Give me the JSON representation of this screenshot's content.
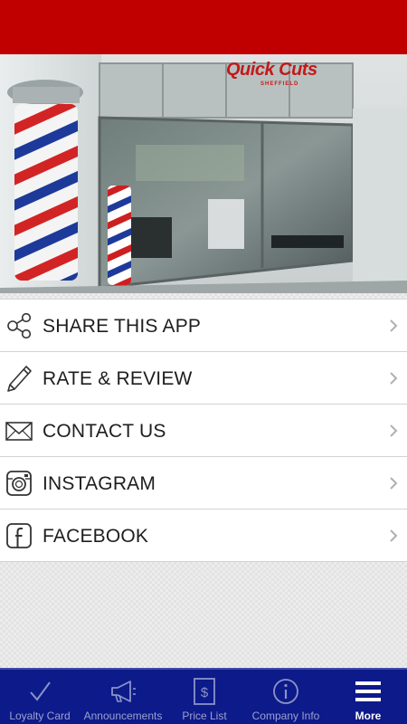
{
  "colors": {
    "header": "#c00000",
    "tab_bar": "#0d1a8a",
    "tab_label": "#9aa1cf",
    "tab_label_active": "#ffffff"
  },
  "hero": {
    "shop_sign": "Quick Cuts",
    "shop_sign_sub": "SHEFFIELD"
  },
  "menu": {
    "items": [
      {
        "label": "SHARE THIS APP",
        "icon": "share-icon"
      },
      {
        "label": "RATE & REVIEW",
        "icon": "pencil-icon"
      },
      {
        "label": "CONTACT US",
        "icon": "envelope-icon"
      },
      {
        "label": "INSTAGRAM",
        "icon": "instagram-icon"
      },
      {
        "label": "FACEBOOK",
        "icon": "facebook-icon"
      }
    ]
  },
  "tabs": [
    {
      "label": "Loyalty Card",
      "icon": "checkmark-icon",
      "active": false
    },
    {
      "label": "Announcements",
      "icon": "megaphone-icon",
      "active": false
    },
    {
      "label": "Price List",
      "icon": "dollar-icon",
      "active": false
    },
    {
      "label": "Company Info",
      "icon": "info-icon",
      "active": false
    },
    {
      "label": "More",
      "icon": "hamburger-icon",
      "active": true
    }
  ]
}
